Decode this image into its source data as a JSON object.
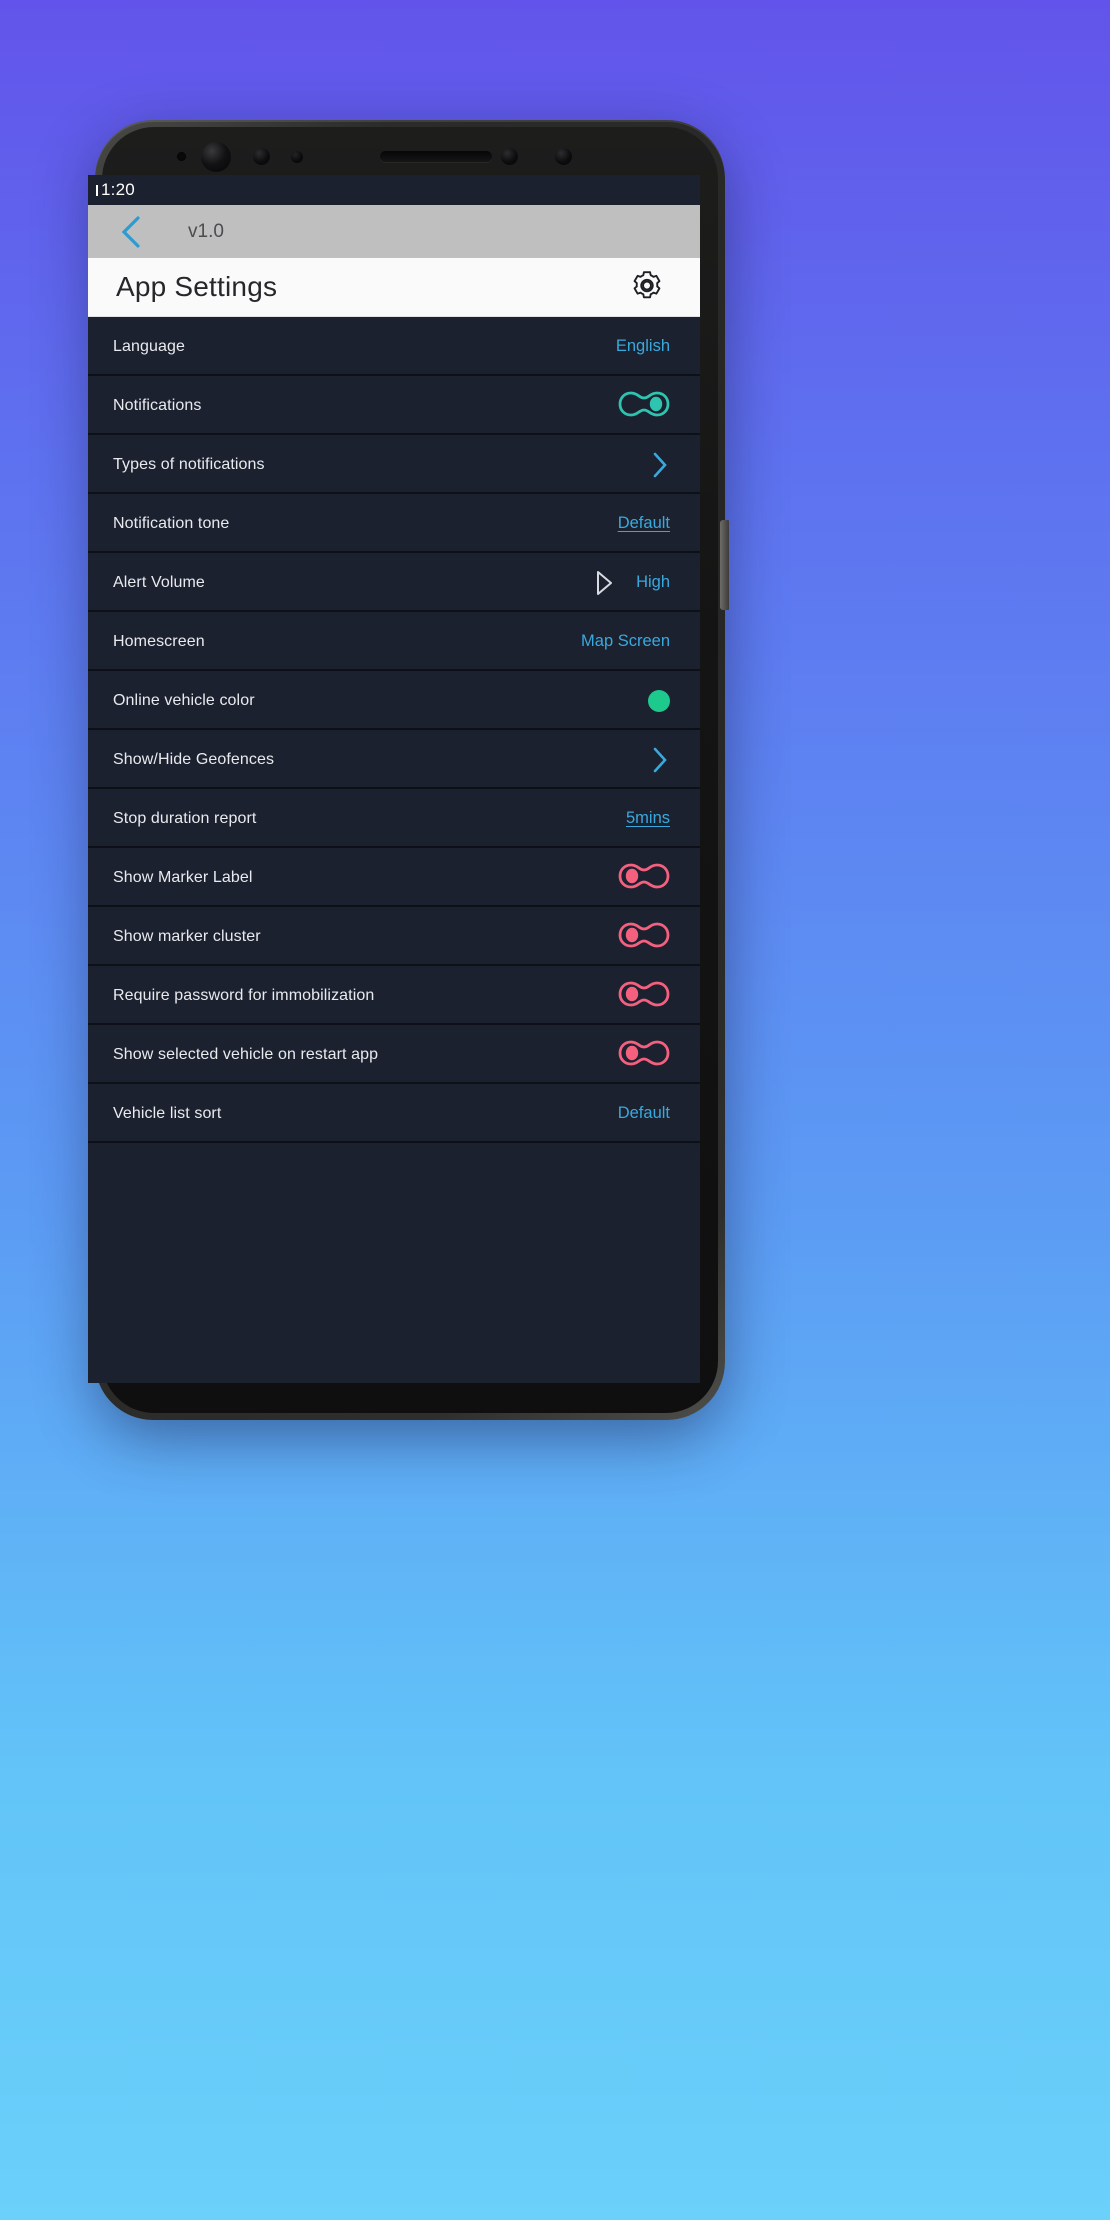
{
  "theme": {
    "bg_gradient_top": "#6254EA",
    "bg_gradient_bottom": "#6BD0FA",
    "screen_bg": "#1C2130",
    "accent_cyan": "#39A9DD",
    "toggle_on": "#2EC4B0",
    "toggle_off": "#F4607E",
    "swatch_green": "#1EC98D"
  },
  "statusbar": {
    "time": "1:20"
  },
  "toolbar": {
    "back_icon": "chevron-left-icon",
    "version": "v1.0"
  },
  "header": {
    "title": "App Settings",
    "settings_icon": "gear-icon"
  },
  "settings": {
    "rows": [
      {
        "label": "Language",
        "control": "value",
        "value": "English",
        "underline": false
      },
      {
        "label": "Notifications",
        "control": "toggle",
        "value": "on"
      },
      {
        "label": "Types of notifications",
        "control": "chevron",
        "icon": "chevron-right-icon"
      },
      {
        "label": "Notification tone",
        "control": "value",
        "value": "Default",
        "underline": true
      },
      {
        "label": "Alert Volume",
        "control": "value",
        "value": "High",
        "underline": false,
        "icon": "play-triangle-icon"
      },
      {
        "label": "Homescreen",
        "control": "value",
        "value": "Map Screen",
        "underline": false
      },
      {
        "label": "Online vehicle color",
        "control": "swatch",
        "value": "#1EC98D"
      },
      {
        "label": "Show/Hide Geofences",
        "control": "chevron",
        "icon": "chevron-right-icon"
      },
      {
        "label": "Stop duration report",
        "control": "value",
        "value": "5mins",
        "underline": true
      },
      {
        "label": "Show Marker Label",
        "control": "toggle",
        "value": "off"
      },
      {
        "label": "Show marker cluster",
        "control": "toggle",
        "value": "off"
      },
      {
        "label": "Require password for immobilization",
        "control": "toggle",
        "value": "off"
      },
      {
        "label": "Show selected vehicle on restart app",
        "control": "toggle",
        "value": "off"
      },
      {
        "label": "Vehicle list sort",
        "control": "value",
        "value": "Default",
        "underline": false
      }
    ]
  }
}
